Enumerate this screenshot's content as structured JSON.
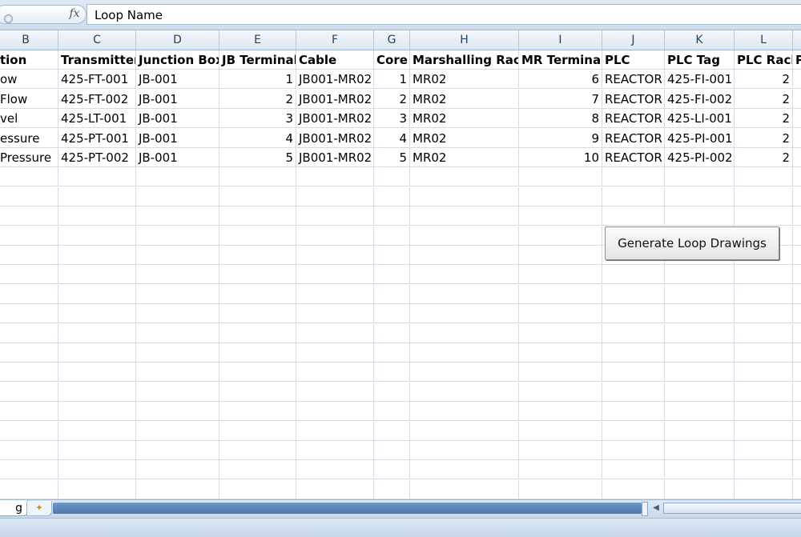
{
  "formula_bar": {
    "fx_label": "fx",
    "value": "Loop Name"
  },
  "columns": [
    {
      "letter": "B",
      "name": "col-b"
    },
    {
      "letter": "C",
      "name": "col-c"
    },
    {
      "letter": "D",
      "name": "col-d"
    },
    {
      "letter": "E",
      "name": "col-e"
    },
    {
      "letter": "F",
      "name": "col-f"
    },
    {
      "letter": "G",
      "name": "col-g"
    },
    {
      "letter": "H",
      "name": "col-h"
    },
    {
      "letter": "I",
      "name": "col-i"
    },
    {
      "letter": "J",
      "name": "col-j"
    },
    {
      "letter": "K",
      "name": "col-k"
    },
    {
      "letter": "L",
      "name": "col-l"
    }
  ],
  "header_row": [
    "tion",
    "Transmitter",
    "Junction Box",
    "JB Terminal",
    "Cable",
    "Core",
    "Marshalling Rack",
    "MR Terminal",
    "PLC",
    "PLC Tag",
    "PLC Rack",
    "P"
  ],
  "data_rows": [
    [
      "ow",
      "425-FT-001",
      "JB-001",
      "1",
      "JB001-MR02",
      "1",
      "MR02",
      "6",
      "REACTOR",
      "425-FI-001",
      "2"
    ],
    [
      "Flow",
      "425-FT-002",
      "JB-001",
      "2",
      "JB001-MR02",
      "2",
      "MR02",
      "7",
      "REACTOR",
      "425-FI-002",
      "2"
    ],
    [
      "vel",
      "425-LT-001",
      "JB-001",
      "3",
      "JB001-MR02",
      "3",
      "MR02",
      "8",
      "REACTOR",
      "425-LI-001",
      "2"
    ],
    [
      "essure",
      "425-PT-001",
      "JB-001",
      "4",
      "JB001-MR02",
      "4",
      "MR02",
      "9",
      "REACTOR",
      "425-PI-001",
      "2"
    ],
    [
      "Pressure",
      "425-PT-002",
      "JB-001",
      "5",
      "JB001-MR02",
      "5",
      "MR02",
      "10",
      "REACTOR",
      "425-PI-002",
      "2"
    ]
  ],
  "generate_button": {
    "label": "Generate Loop Drawings"
  },
  "sheet_tab": {
    "label": "g"
  }
}
